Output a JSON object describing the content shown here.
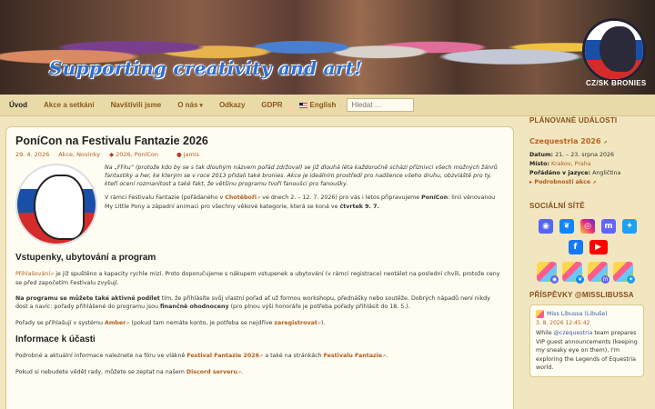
{
  "banner": {
    "slogan": "Supporting creativity and art!",
    "logo_text": "CZ/SK BRONIES"
  },
  "nav": {
    "items": [
      {
        "label": "Úvod",
        "active": true
      },
      {
        "label": "Akce a setkání"
      },
      {
        "label": "Navštívili jsme"
      },
      {
        "label": "O nás"
      },
      {
        "label": "Odkazy"
      },
      {
        "label": "GDPR"
      },
      {
        "label": "English"
      }
    ],
    "search_placeholder": "Hledat …"
  },
  "article": {
    "title": "PoníCon na Festivalu Fantazie 2026",
    "date": "29. 4. 2026",
    "categories": "Akce, Novinky",
    "tags": "2026, PoníCon",
    "author": "jamis",
    "intro_p1": "Na „FFku“ (protože kdo by se s tak dlouhým názvem pořád zdržoval) se již dlouhá léta každoročně schází příznivci všech možných žánrů fantastiky a her, ke kterým se v roce 2013 přidali také bronies. Akce je ideálním prostředí pro nadšence všeho druhu, obzvláště pro ty, kteří ocení rozmanitost a také fakt, že většinu programu tvoří fanoušci pro fanoušky.",
    "intro_p2_a": "V rámci Festivalu Fantazie (pořádaného v ",
    "intro_p2_link": "Chotěboři",
    "intro_p2_b": " ve dnech 2. – 12. 7. 2026) pro vás i letos připravujeme ",
    "intro_p2_strong": "PoníCon",
    "intro_p2_c": ": linii věnovanou My Little Pony a západní animaci pro všechny věkové kategorie, která se koná ve ",
    "intro_p2_day": "čtvrtek 9. 7.",
    "h2_tickets": "Vstupenky, ubytování a program",
    "p_reg_link": "Přihlašování",
    "p_reg_text": " je již spuštěno a kapacity rychle mizí. Proto doporučujeme s nákupem vstupenek a ubytování (v rámci registrace) neotálet na poslední chvíli, protože ceny se před započetím Festivalu zvyšují.",
    "p_prog_strong": "Na programu se můžete také aktivně podílet",
    "p_prog_a": " tím, že přihlásíte svůj vlastní pořad ať už formou workshopu, přednášky nebo soutěže. Dobrých nápadů není nikdy dost a navíc: pořady přihlášené do programu jsou ",
    "p_prog_strong2": "finančně ohodnoceny",
    "p_prog_b": " (pro plnou výši honoráře je potřeba pořady přihlásit do 18. 5.).",
    "p_amber_a": "Pořady se přihlašují v systému ",
    "p_amber_link": "Amber",
    "p_amber_b": " (pokud tam nemáte konto, je potřeba se nejdříve ",
    "p_amber_link2": "zaregistrovat",
    "p_amber_c": ").",
    "h2_info": "Informace k účasti",
    "p_info_a": "Podrobné a aktuální informace naleznete na fóru ve vlákně ",
    "p_info_link": "Festival Fantazie 2026",
    "p_info_b": " a také na stránkách ",
    "p_info_link2": "Festivalu Fantazie",
    "p_info_c": ".",
    "p_discord_a": "Pokud si nebudete vědět rady, můžete se zeptat na našem ",
    "p_discord_link": "Discord serveru",
    "p_discord_b": "."
  },
  "sidebar": {
    "events_heading": "PLÁNOVANÉ UDÁLOSTI",
    "event_name": "Czequestria 2026",
    "date_label": "Datum:",
    "date_value": "21. – 23. srpna 2026",
    "place_label": "Místo:",
    "place_value": "Krakov, Praha",
    "lang_label": "Pořádáno v jazyce:",
    "lang_value": "Angličtina",
    "more": "Podrobnosti akce",
    "social_heading": "SOCIÁLNÍ SÍTĚ",
    "social_icons": [
      "discord-icon",
      "bluesky-icon",
      "instagram-icon",
      "mastodon-icon",
      "twitter-icon",
      "facebook-icon",
      "youtube-icon"
    ],
    "pony_icons": [
      "discord",
      "bluesky",
      "mastodon",
      "twitter"
    ],
    "posts_heading": "PŘÍSPĚVKY @MISSLIBUSSA",
    "post_author": "Miss Libussa (Libuše)",
    "post_date": "3. 8. 2026 12:45:42",
    "post_a": "While ",
    "post_mention": "@czequestria",
    "post_b": " team prepares VIP guest announcements (keeping my sneaky eye on them), I'm exploring the Legends of Equestria world."
  },
  "colors": {
    "accent": "#b25b1e",
    "heading": "#8a4e1a",
    "background": "#f1e6bf",
    "card": "#fffdf2"
  }
}
